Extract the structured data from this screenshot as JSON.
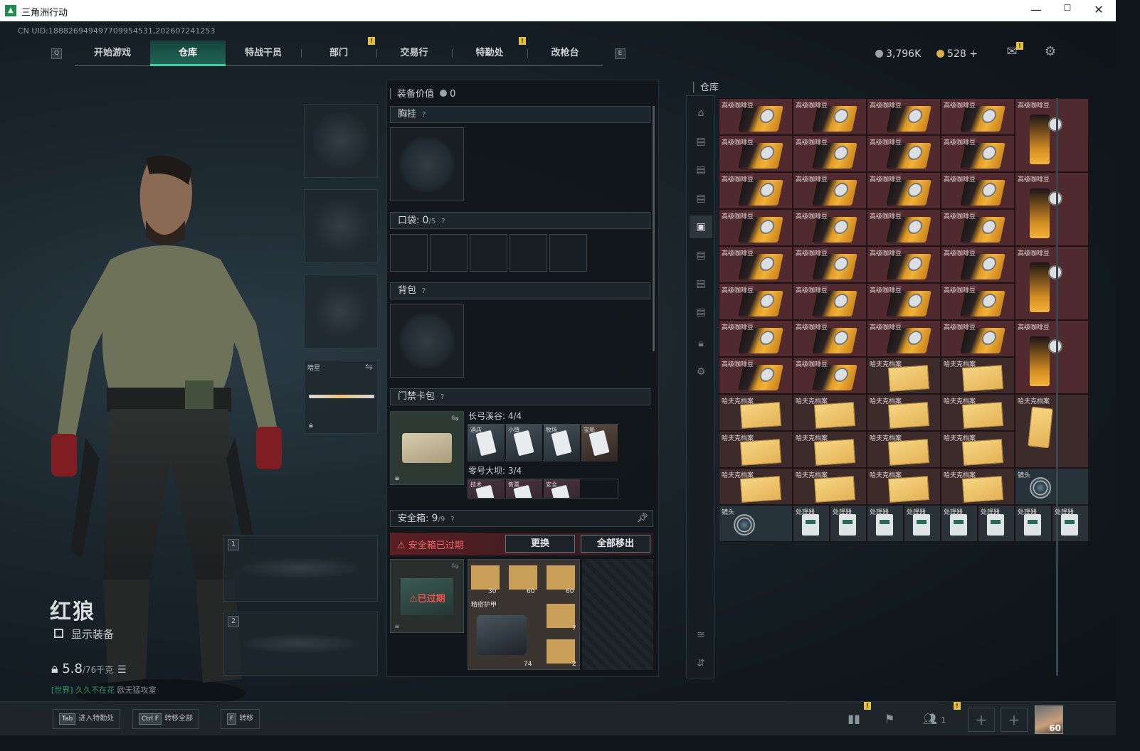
{
  "window": {
    "title": "三角洲行动",
    "min": "—",
    "max": "☐",
    "close": "✕"
  },
  "header": {
    "uid": "CN UID:188826949497709954531,202607241253",
    "key_left": "Q",
    "key_right": "E",
    "tabs": [
      "开始游戏",
      "仓库",
      "特战干员",
      "部门",
      "交易行",
      "特勤处",
      "改枪台"
    ],
    "active_tab": 1,
    "badge": "!",
    "currency1": "3,796K",
    "currency2": "528",
    "currency_plus": "+",
    "mail_icon": "mail-icon",
    "settings_icon": "gear-icon"
  },
  "operator": {
    "name": "红狼",
    "show_equipment": "显示装备",
    "weight": "5.8",
    "weight_cap": "/76千克",
    "chat_channel": "[世界]",
    "chat_user": "久久不在花",
    "chat_msg": "欧无猛攻室",
    "melee_label": "暗星",
    "slot1": "1",
    "slot2": "2"
  },
  "loadout": {
    "equip_value_label": "装备价值",
    "equip_value": "0",
    "chest": "胸挂",
    "pocket": "口袋:",
    "pocket_count": "0",
    "pocket_cap": "/5",
    "backpack": "背包",
    "keycard": "门禁卡包",
    "keycard_group1": "长弓溪谷: 4/4",
    "keycard_group2": "零号大坝: 3/4",
    "cards1": [
      "酒店",
      "小镇",
      "牧场",
      "宝船"
    ],
    "cards2": [
      "技术",
      "售票",
      "安全"
    ],
    "safebox": "安全箱:",
    "safebox_count": "9",
    "safebox_cap": "/9",
    "safebox_warning": "安全箱已过期",
    "replace_btn": "更换",
    "move_all_btn": "全部移出",
    "expired": "已过期",
    "safebox_item_label": "精密护甲",
    "qty": [
      "30",
      "60",
      "60",
      "7",
      "74",
      "2"
    ],
    "q": "?"
  },
  "warehouse": {
    "title": "仓库",
    "items": {
      "coffee": "高级咖啡豆",
      "file": "哈夫克档案",
      "lens": "镜头",
      "proc": "处理器"
    }
  },
  "bottom": {
    "hints": [
      {
        "key": "Tab",
        "label": "进入特勤处"
      },
      {
        "key": "Ctrl F",
        "label": "转移全部"
      },
      {
        "key": "F",
        "label": "转移"
      }
    ],
    "friends_count": "1",
    "level": "60",
    "badge": "!"
  },
  "colors": {
    "accent": "#3fd0a5",
    "warning": "#e24a4a",
    "coffee_bg": "#502a2e",
    "file_bg": "#3c2b2a",
    "badge": "#e7bf3a"
  }
}
